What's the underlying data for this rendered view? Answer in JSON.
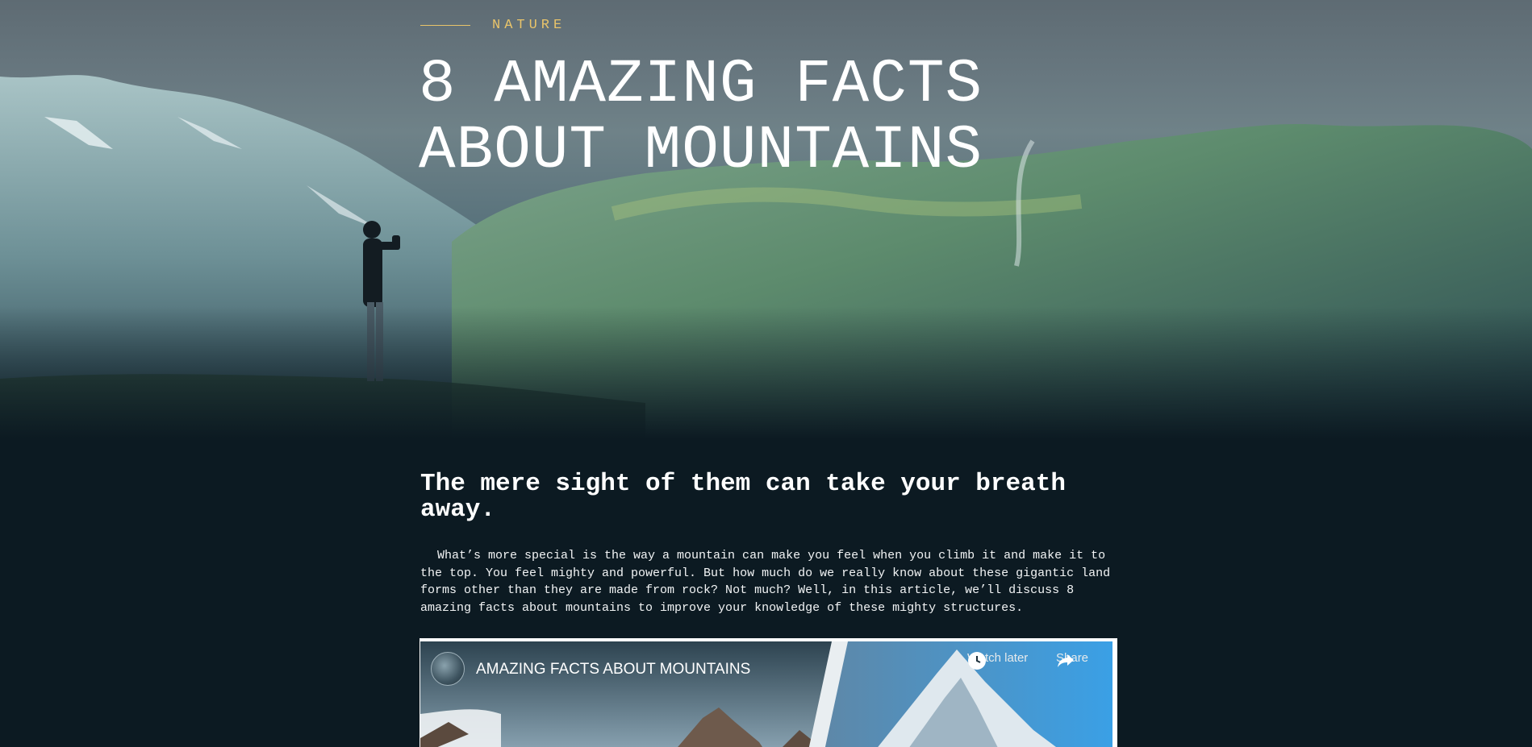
{
  "hero": {
    "kicker": "NATURE",
    "title_line1": "8 AMAZING FACTS",
    "title_line2": "ABOUT MOUNTAINS"
  },
  "article": {
    "subheading": "The mere sight of them can take your breath away.",
    "body": "What’s more special is the way a mountain can make you feel when you climb it and make it to the top. You feel mighty and powerful. But how much do we really know about these gigantic land forms other than they are made from rock? Not much? Well, in this article, we’ll discuss 8 amazing facts about mountains to improve your knowledge of these mighty structures."
  },
  "video": {
    "title": "AMAZING FACTS ABOUT MOUNTAINS",
    "watch_later": "Watch later",
    "share": "Share"
  },
  "colors": {
    "background": "#0c1a22",
    "accent": "#e9c46a",
    "text": "#ffffff"
  }
}
